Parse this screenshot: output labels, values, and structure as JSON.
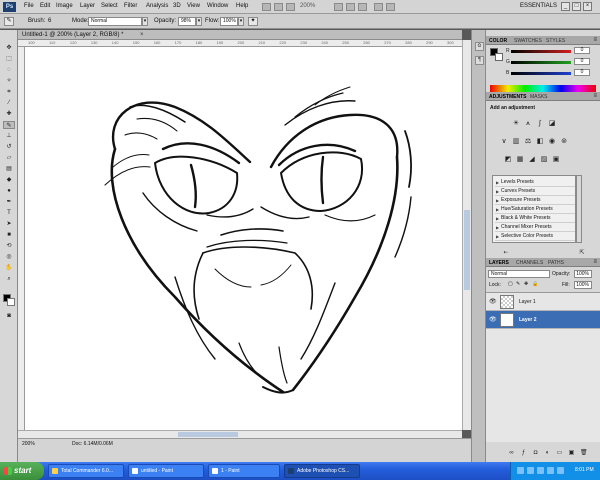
{
  "app": {
    "logo": "Ps",
    "menus": [
      "File",
      "Edit",
      "Image",
      "Layer",
      "Select",
      "Filter",
      "Analysis",
      "3D",
      "View",
      "Window",
      "Help"
    ],
    "zoom": "200%",
    "workspace": "ESSENTIALS",
    "window_buttons": [
      "_",
      "□",
      "×"
    ]
  },
  "options_bar": {
    "brush_label": "Brush:",
    "brush_size": "6",
    "mode_label": "Mode:",
    "mode_value": "Normal",
    "opacity_label": "Opacity:",
    "opacity_value": "98%",
    "flow_label": "Flow:",
    "flow_value": "100%"
  },
  "document": {
    "tab_title": "Untitled-1 @ 200% (Layer 2, RGB/8) *",
    "close_glyph": "×",
    "ruler_marks": [
      "100",
      "110",
      "120",
      "130",
      "140",
      "150",
      "160",
      "170",
      "180",
      "190",
      "200",
      "210",
      "220",
      "230",
      "240",
      "250",
      "260",
      "270",
      "280",
      "290",
      "300"
    ]
  },
  "status_bar": {
    "zoom": "200%",
    "doc_size": "Doc: 6.14M/0.06M"
  },
  "color_panel": {
    "tabs": [
      "COLOR",
      "SWATCHES",
      "STYLES"
    ],
    "channels": [
      {
        "label": "R",
        "value": "0",
        "color": "#d02020"
      },
      {
        "label": "G",
        "value": "0",
        "color": "#20a020"
      },
      {
        "label": "B",
        "value": "0",
        "color": "#2040d0"
      }
    ]
  },
  "adjustments_panel": {
    "tabs": [
      "ADJUSTMENTS",
      "MASKS"
    ],
    "title": "Add an adjustment",
    "presets": [
      "Levels Presets",
      "Curves Presets",
      "Exposure Presets",
      "Hue/Saturation Presets",
      "Black & White Presets",
      "Channel Mixer Presets",
      "Selective Color Presets"
    ]
  },
  "layers_panel": {
    "tabs": [
      "LAYERS",
      "CHANNELS",
      "PATHS"
    ],
    "blend_mode": "Normal",
    "opacity_label": "Opacity:",
    "opacity_value": "100%",
    "lock_label": "Lock:",
    "fill_label": "Fill:",
    "fill_value": "100%",
    "layers": [
      {
        "name": "Layer 1",
        "selected": false
      },
      {
        "name": "Layer 2",
        "selected": true
      }
    ]
  },
  "taskbar": {
    "start_label": "start",
    "tasks": [
      {
        "label": "Total Commander 6.0...",
        "active": false,
        "icon_color": "#ffd24a"
      },
      {
        "label": "untitled - Paint",
        "active": false,
        "icon_color": "#ffffff"
      },
      {
        "label": "1 - Paint",
        "active": false,
        "icon_color": "#ffffff"
      },
      {
        "label": "Adobe Photoshop CS...",
        "active": true,
        "icon_color": "#1d3f70"
      }
    ],
    "clock": "8:01 PM"
  }
}
